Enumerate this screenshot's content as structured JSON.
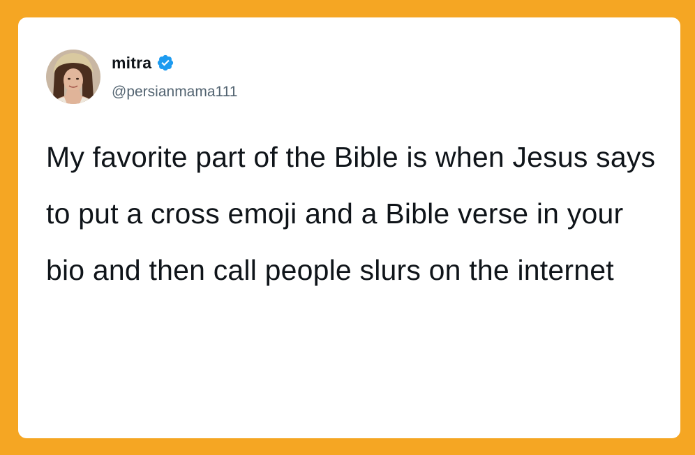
{
  "tweet": {
    "author": {
      "display_name": "mitra",
      "handle": "@persianmama111",
      "verified": true,
      "avatar_icon": "profile-photo",
      "verified_icon": "verified-badge-icon"
    },
    "text": "My favorite part of the Bible is when Jesus says to put a cross emoji and a Bible verse in your bio and then call people slurs on the internet"
  },
  "colors": {
    "background": "#F5A623",
    "card": "#FFFFFF",
    "text_primary": "#0F1419",
    "text_secondary": "#536471",
    "verified": "#1D9BF0"
  }
}
